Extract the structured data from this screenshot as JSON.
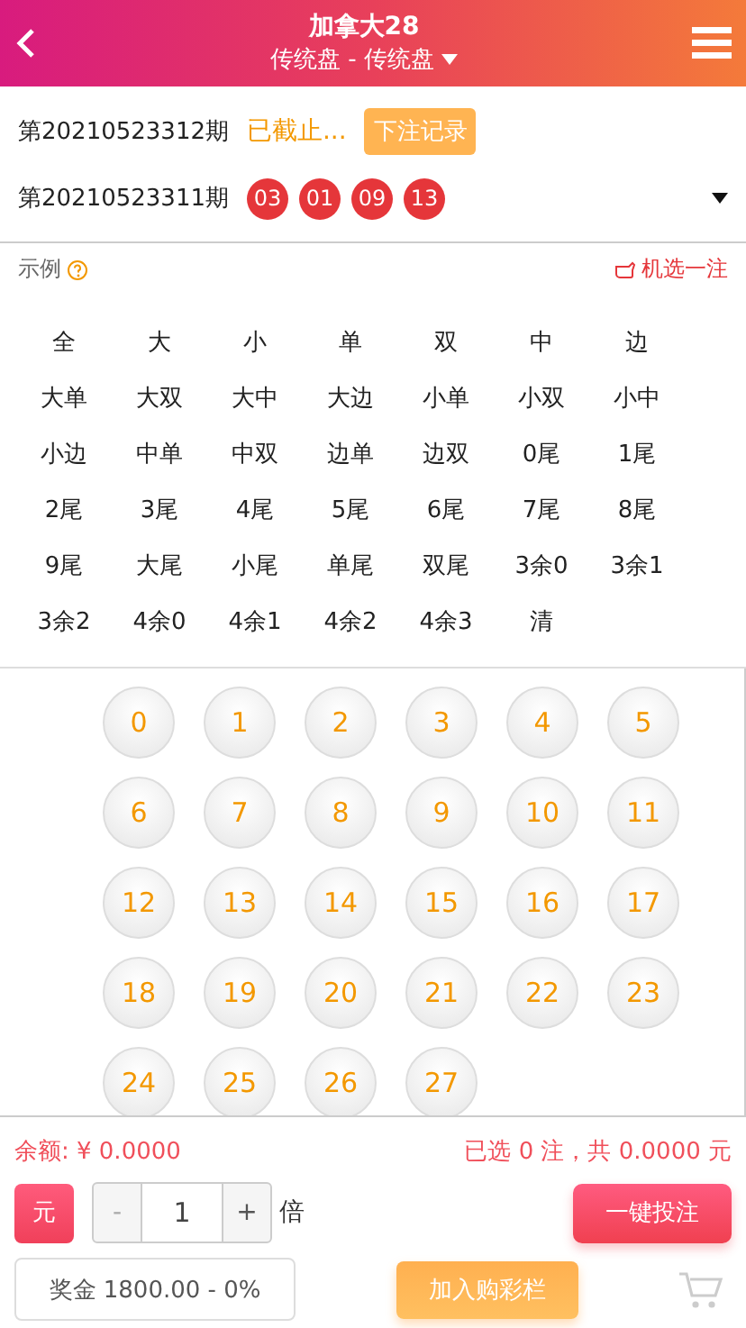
{
  "header": {
    "title": "加拿大28",
    "subtitle": "传统盘 - 传统盘"
  },
  "current_issue": {
    "issue": "第20210523312期",
    "status": "已截止...",
    "history_button": "下注记录"
  },
  "last_issue": {
    "issue": "第20210523311期",
    "numbers": [
      "03",
      "01",
      "09",
      "13"
    ]
  },
  "example": {
    "label": "示例",
    "random_pick": "机选一注"
  },
  "quick_picks": [
    "全",
    "大",
    "小",
    "单",
    "双",
    "中",
    "边",
    "大单",
    "大双",
    "大中",
    "大边",
    "小单",
    "小双",
    "小中",
    "小边",
    "中单",
    "中双",
    "边单",
    "边双",
    "0尾",
    "1尾",
    "2尾",
    "3尾",
    "4尾",
    "5尾",
    "6尾",
    "7尾",
    "8尾",
    "9尾",
    "大尾",
    "小尾",
    "单尾",
    "双尾",
    "3余0",
    "3余1",
    "3余2",
    "4余0",
    "4余1",
    "4余2",
    "4余3",
    "清"
  ],
  "balls": [
    "0",
    "1",
    "2",
    "3",
    "4",
    "5",
    "6",
    "7",
    "8",
    "9",
    "10",
    "11",
    "12",
    "13",
    "14",
    "15",
    "16",
    "17",
    "18",
    "19",
    "20",
    "21",
    "22",
    "23",
    "24",
    "25",
    "26",
    "27"
  ],
  "footer": {
    "balance": "余额: ¥ 0.0000",
    "summary": "已选 0 注，共 0.0000 元",
    "unit": "元",
    "minus": "-",
    "multiplier": "1",
    "plus": "+",
    "multiplier_unit": "倍",
    "bet_button": "一键投注",
    "prize": "奖金 1800.00 - 0%",
    "cart_button": "加入购彩栏"
  }
}
